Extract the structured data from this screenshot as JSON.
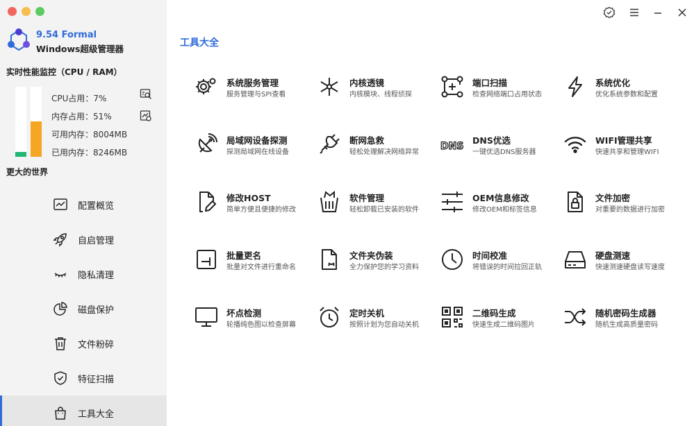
{
  "app": {
    "version": "9.54 Formal",
    "name": "Windows超级管理器"
  },
  "colors": {
    "accent": "#2f6bd9",
    "cpu_bar": "#22b573",
    "mem_bar": "#f5a623",
    "traffic_close": "#f2665c",
    "traffic_min": "#f6be4f",
    "traffic_max": "#5ccb5f"
  },
  "monitor": {
    "title": "实时性能监控（CPU / RAM）",
    "cpu_label": "CPU占用：7%",
    "mem_label": "内存占用：51%",
    "free_label": "可用内存：8004MB",
    "used_label": "已用内存：8246MB",
    "cpu_percent": 7,
    "mem_percent": 51
  },
  "slogan": "更大的世界",
  "nav": {
    "items": [
      {
        "label": "配置概览",
        "icon": "chart-line-icon"
      },
      {
        "label": "自启管理",
        "icon": "rocket-icon"
      },
      {
        "label": "隐私清理",
        "icon": "eye-closed-icon"
      },
      {
        "label": "磁盘保护",
        "icon": "pie-chart-icon"
      },
      {
        "label": "文件粉碎",
        "icon": "trash-icon"
      },
      {
        "label": "特征扫描",
        "icon": "shield-check-icon"
      },
      {
        "label": "工具大全",
        "icon": "bag-icon"
      }
    ],
    "active_index": 6
  },
  "main": {
    "title": "工具大全",
    "tools": [
      {
        "name": "系统服务管理",
        "desc": "服务管理与SPI查看",
        "icon": "gears-icon"
      },
      {
        "name": "内核透镜",
        "desc": "内核模块、线程侦探",
        "icon": "network-node-icon"
      },
      {
        "name": "端口扫描",
        "desc": "检查网络端口占用状态",
        "icon": "port-scan-icon"
      },
      {
        "name": "系统优化",
        "desc": "优化系统参数和配置",
        "icon": "lightning-icon"
      },
      {
        "name": "局域网设备探测",
        "desc": "探测局域网在线设备",
        "icon": "satellite-dish-icon"
      },
      {
        "name": "断网急救",
        "desc": "轻松处理解决网络异常",
        "icon": "plug-icon"
      },
      {
        "name": "DNS优选",
        "desc": "一键优选DNS服务器",
        "icon": "dns-icon",
        "glyph": "DNS"
      },
      {
        "name": "WIFI管理共享",
        "desc": "快速共享和管理WIFI",
        "icon": "wifi-icon"
      },
      {
        "name": "修改HOST",
        "desc": "简单方便且便捷的修改",
        "icon": "edit-file-icon"
      },
      {
        "name": "软件管理",
        "desc": "轻松卸载已安装的软件",
        "icon": "uninstall-icon"
      },
      {
        "name": "OEM信息修改",
        "desc": "修改OEM和标签信息",
        "icon": "sliders-icon"
      },
      {
        "name": "文件加密",
        "desc": "对重要的数据进行加密",
        "icon": "file-lock-icon"
      },
      {
        "name": "批量更名",
        "desc": "批量对文件进行重命名",
        "icon": "rename-icon"
      },
      {
        "name": "文件夹伪装",
        "desc": "全力保护您的学习资料",
        "icon": "file-mask-icon"
      },
      {
        "name": "时间校准",
        "desc": "将错误的时间拉回正轨",
        "icon": "clock-icon"
      },
      {
        "name": "硬盘测速",
        "desc": "快速测速硬盘读写速度",
        "icon": "hard-drive-icon"
      },
      {
        "name": "坏点检测",
        "desc": "轮播纯色图以检查屏幕",
        "icon": "monitor-icon"
      },
      {
        "name": "定时关机",
        "desc": "按照计划为您自动关机",
        "icon": "alarm-clock-icon"
      },
      {
        "name": "二维码生成",
        "desc": "快速生成二维码图片",
        "icon": "qrcode-icon"
      },
      {
        "name": "随机密码生成器",
        "desc": "随机生成高质量密码",
        "icon": "shuffle-icon"
      }
    ]
  }
}
